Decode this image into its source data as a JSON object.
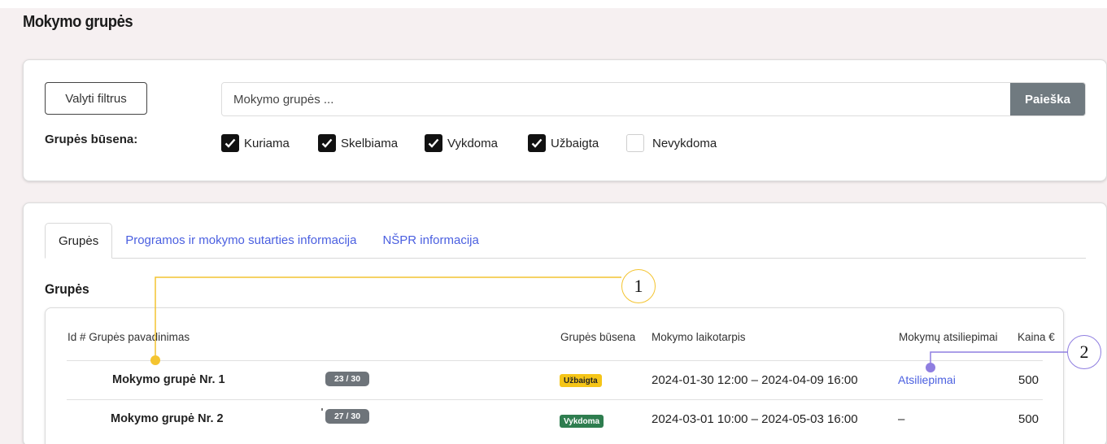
{
  "page": {
    "title": "Mokymo grupės"
  },
  "filters": {
    "clear_label": "Valyti filtrus",
    "search_placeholder": "Mokymo grupės ...",
    "search_button": "Paieška",
    "status_label": "Grupės būsena:",
    "options": [
      {
        "label": "Kuriama",
        "checked": true
      },
      {
        "label": "Skelbiama",
        "checked": true
      },
      {
        "label": "Vykdoma",
        "checked": true
      },
      {
        "label": "Užbaigta",
        "checked": true
      },
      {
        "label": "Nevykdoma",
        "checked": false
      }
    ]
  },
  "tabs": [
    {
      "label": "Grupės",
      "active": true
    },
    {
      "label": "Programos ir mokymo sutarties informacija",
      "active": false
    },
    {
      "label": "NŠPR informacija",
      "active": false
    }
  ],
  "section": {
    "title": "Grupės"
  },
  "table": {
    "headers": {
      "id_name": "Id # Grupės pavadinimas",
      "status": "Grupės būsena",
      "period": "Mokymo laikotarpis",
      "feedback": "Mokymų atsiliepimai",
      "price": "Kaina €"
    },
    "rows": [
      {
        "name": "Mokymo grupė Nr. 1",
        "capacity": "23 / 30",
        "status": "Užbaigta",
        "status_color": "#f5c518",
        "period": "2024-01-30 12:00 – 2024-04-09 16:00",
        "feedback": "Atsiliepimai",
        "price": "500"
      },
      {
        "name": "Mokymo grupė Nr. 2",
        "capacity": "27 / 30",
        "status": "Vykdoma",
        "status_color": "#2e7d4f",
        "period": "2024-03-01 10:00 – 2024-05-03 16:00",
        "feedback": "–",
        "price": "500"
      }
    ]
  },
  "annotations": [
    {
      "label": "1",
      "color": "#f4c430"
    },
    {
      "label": "2",
      "color": "#8f7ee0"
    }
  ],
  "colors": {
    "accent": "#4a5fe0",
    "page_bg": "#f6f0f1"
  }
}
